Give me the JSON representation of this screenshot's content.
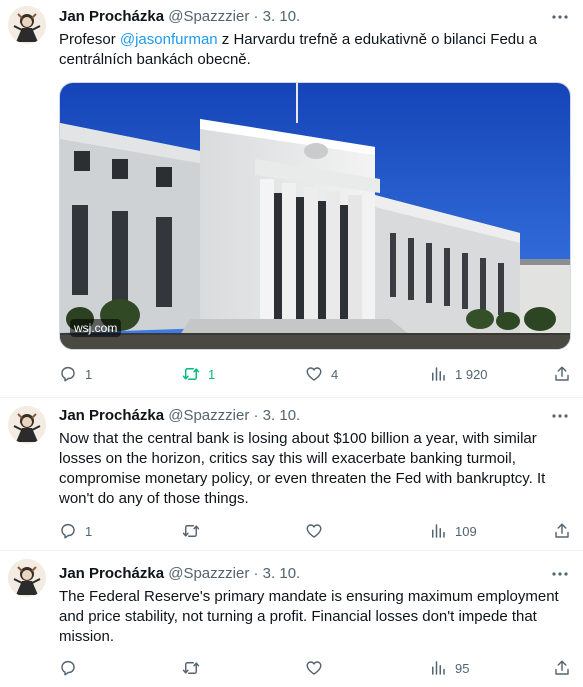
{
  "tweets": [
    {
      "author": {
        "name": "Jan Procházka",
        "handle": "@Spazzzier"
      },
      "separator": "·",
      "date": "3. 10.",
      "text_before": "Profesor ",
      "mention": "@jasonfurman",
      "text_after": " z Harvardu trefně a edukativně o bilanci Fedu a centrálních bankách obecně.",
      "media_source": "wsj.com",
      "replies": "1",
      "reposts": "1",
      "likes": "4",
      "views": "1 920"
    },
    {
      "author": {
        "name": "Jan Procházka",
        "handle": "@Spazzzier"
      },
      "separator": "·",
      "date": "3. 10.",
      "text": "Now that the central bank is losing about $100 billion a year, with similar losses on the horizon, critics say this will exacerbate banking turmoil, compromise monetary policy, or even threaten the Fed with bankruptcy. It won't do any of those things.",
      "replies": "1",
      "reposts": "",
      "likes": "",
      "views": "109"
    },
    {
      "author": {
        "name": "Jan Procházka",
        "handle": "@Spazzzier"
      },
      "separator": "·",
      "date": "3. 10.",
      "text": "The Federal Reserve's primary mandate is ensuring maximum employment and price stability, not turning a profit. Financial losses don't impede that mission.",
      "replies": "",
      "reposts": "",
      "likes": "",
      "views": "95"
    }
  ],
  "colors": {
    "accent": "#1d9bf0",
    "repost_active": "#00ba7c",
    "muted": "#536471"
  },
  "icons": [
    "more-icon",
    "reply-icon",
    "repost-icon",
    "like-icon",
    "views-icon",
    "share-icon"
  ]
}
